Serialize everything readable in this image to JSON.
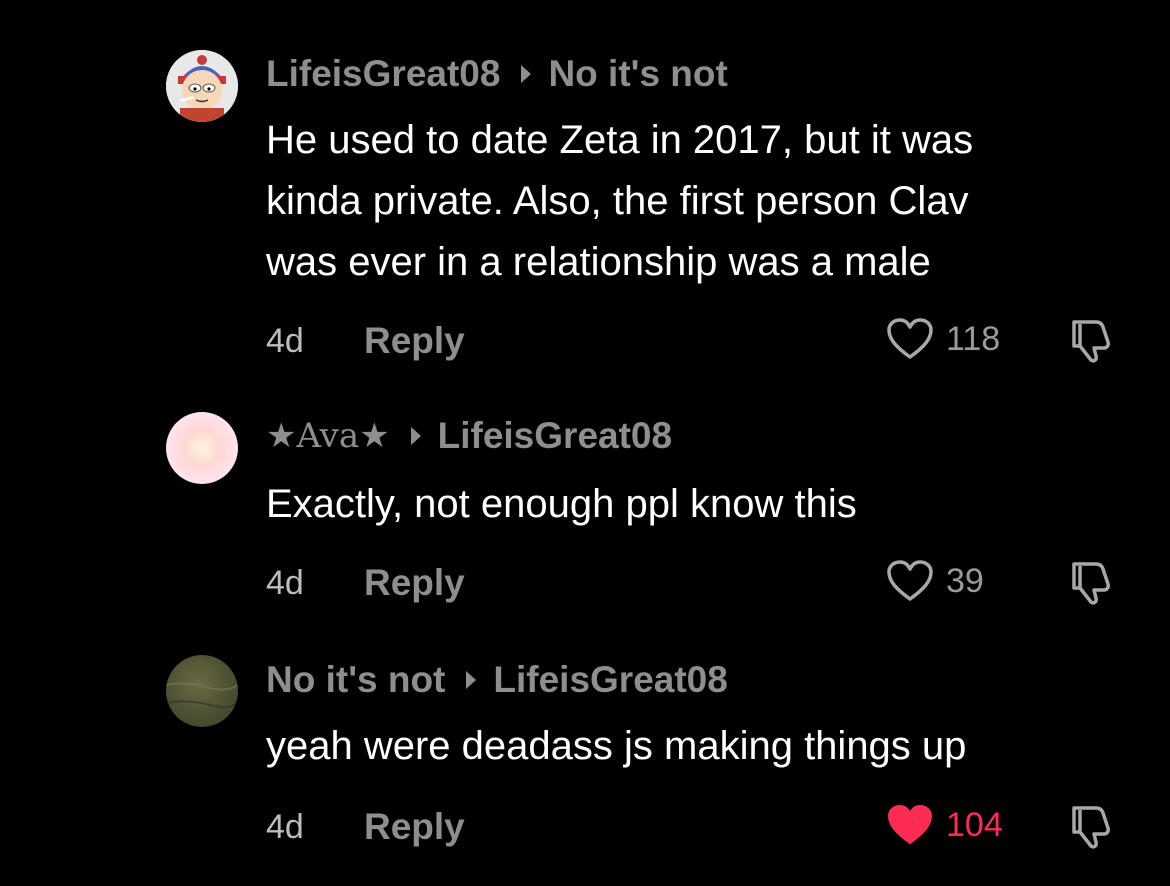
{
  "comments": [
    {
      "author": "LifeisGreat08",
      "reply_to": "No it's not",
      "text_lines": [
        "He used to date Zeta in 2017, but it was",
        "kinda private. Also, the first person Clav",
        "was ever in a relationship was a male"
      ],
      "age": "4d",
      "reply_label": "Reply",
      "likes": "118",
      "liked": false
    },
    {
      "author": "★Ava★",
      "reply_to": "LifeisGreat08",
      "text_lines": [
        "Exactly, not enough ppl know this"
      ],
      "age": "4d",
      "reply_label": "Reply",
      "likes": "39",
      "liked": false
    },
    {
      "author": "No it's not",
      "reply_to": "LifeisGreat08",
      "text_lines": [
        "yeah were deadass js making things up"
      ],
      "age": "4d",
      "reply_label": "Reply",
      "likes": "104",
      "liked": true
    }
  ],
  "colors": {
    "background": "#000000",
    "muted_text": "#8e8e8e",
    "liked": "#fe2c55"
  },
  "icons": {
    "arrow": "reply-arrow-icon",
    "like": "heart-icon",
    "dislike": "thumbs-down-icon"
  }
}
